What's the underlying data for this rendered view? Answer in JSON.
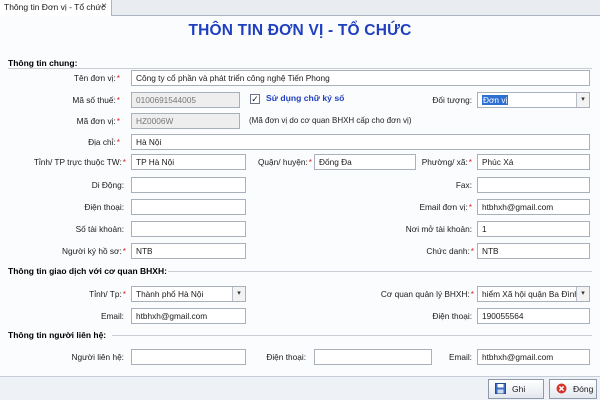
{
  "tab": {
    "label": "Thông tin Đơn vị - Tổ chức",
    "close": "×"
  },
  "title": "THÔN TIN ĐƠN VỊ - TỔ CHỨC",
  "sections": {
    "general": "Thông tin chung:",
    "bhxh": "Thông tin giao dịch với cơ quan BHXH:",
    "contact": "Thông tin người liên hệ:"
  },
  "fields": {
    "ten_don_vi": {
      "label": "Tên đơn vị:",
      "value": "Công ty cổ phần và phát triển công nghệ Tiến Phong"
    },
    "ma_so_thue": {
      "label": "Mã số thuế:",
      "value": "0100691544005"
    },
    "su_dung_chu_ky_so": {
      "label": "Sử dụng chữ ký số",
      "checked": true
    },
    "doi_tuong": {
      "label": "Đối tượng:",
      "value": "Đơn vị"
    },
    "ma_don_vi": {
      "label": "Mã đơn vị:",
      "value": "HZ0006W",
      "note": "(Mã đơn vị do cơ quan BHXH cấp cho đơn vị)"
    },
    "dia_chi": {
      "label": "Địa chỉ:",
      "value": "Hà Nội"
    },
    "tinh_tp": {
      "label": "Tỉnh/ TP trực thuộc TW:",
      "value": "TP Hà Nội"
    },
    "quan_huyen": {
      "label": "Quận/ huyện:",
      "value": "Đống Đa"
    },
    "phuong_xa": {
      "label": "Phường/ xã:",
      "value": "Phúc Xá"
    },
    "di_dong": {
      "label": "Di Động:",
      "value": ""
    },
    "fax": {
      "label": "Fax:",
      "value": ""
    },
    "dien_thoai": {
      "label": "Điện thoại:",
      "value": ""
    },
    "email_don_vi": {
      "label": "Email đơn vị:",
      "value": "htbhxh@gmail.com"
    },
    "so_tai_khoan": {
      "label": "Số tài khoản:",
      "value": ""
    },
    "noi_mo_tai_khoan": {
      "label": "Nơi mở tài khoản:",
      "value": "1"
    },
    "nguoi_ky_ho_so": {
      "label": "Người ký hồ sơ:",
      "value": "NTB"
    },
    "chuc_danh": {
      "label": "Chức danh:",
      "value": "NTB"
    }
  },
  "bhxh": {
    "tinh_tp": {
      "label": "Tỉnh/ Tp:",
      "value": "Thành phố Hà Nội"
    },
    "co_quan_quan_ly": {
      "label": "Cơ quan quản lý BHXH:",
      "value": "hiểm Xã hội quận Ba Đình"
    },
    "email": {
      "label": "Email:",
      "value": "htbhxh@gmail.com"
    },
    "dien_thoai": {
      "label": "Điện thoại:",
      "value": "190055564"
    }
  },
  "contact": {
    "nguoi_lien_he": {
      "label": "Người liên hệ:",
      "value": ""
    },
    "dien_thoai": {
      "label": "Điện thoại:",
      "value": ""
    },
    "email": {
      "label": "Email:",
      "value": "htbhxh@gmail.com"
    }
  },
  "buttons": {
    "save": "Ghi",
    "close": "Đóng"
  },
  "required_mark": "*",
  "dropdown_glyph": "▾",
  "colors": {
    "title": "#1f3fbf",
    "required": "#e02020",
    "selection": "#2f6fd3"
  }
}
